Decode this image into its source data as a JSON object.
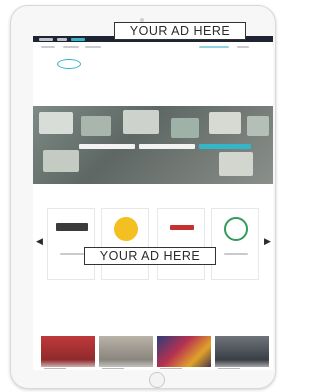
{
  "ads": {
    "top": "YOUR AD HERE",
    "middle": "YOUR AD HERE"
  },
  "colors": {
    "topbar": "#1f2433",
    "accent": "#34b6c8",
    "logo_blue": "#1f4f8f",
    "ad_border": "#333333"
  },
  "icons": [
    "chevron-left-icon",
    "chevron-right-icon"
  ]
}
